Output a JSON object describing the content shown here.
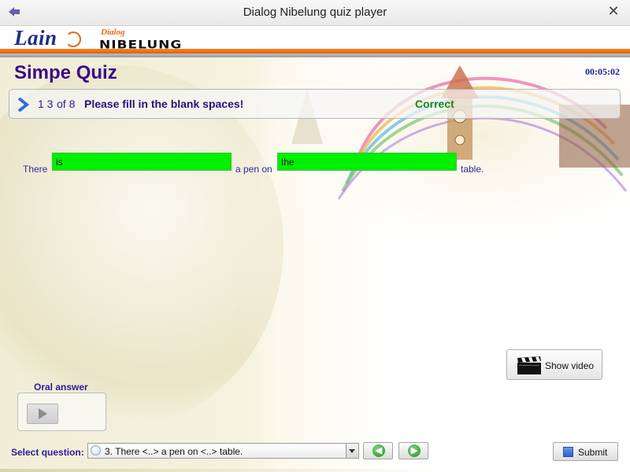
{
  "window": {
    "title": "Dialog Nibelung quiz player",
    "close_glyph": "✕",
    "app_icon": "app-icon"
  },
  "header": {
    "logo_text": "Lain",
    "brand_dialog": "Dialog",
    "brand_name": "NIBELUNG"
  },
  "quiz": {
    "title": "Simpe Quiz",
    "timer": "00:05:02",
    "question_number": "1 3",
    "question_of": "of 8",
    "instruction": "Please fill in the blank spaces!",
    "status": "Correct",
    "status_color": "#138a17"
  },
  "sentence": {
    "word1": "There",
    "blank1": "is",
    "word2": "a pen on",
    "blank2": "the",
    "word3": "table.",
    "blank_color": "#00f000"
  },
  "oral_answer": {
    "label": "Oral answer"
  },
  "video": {
    "label": "Show video",
    "icon": "clapperboard-icon"
  },
  "bottom": {
    "select_label": "Select question:",
    "selected_question": "3. There <..> a pen on <..> table.",
    "prev_glyph": "◀",
    "next_glyph": "▶",
    "submit_label": "Submit"
  }
}
